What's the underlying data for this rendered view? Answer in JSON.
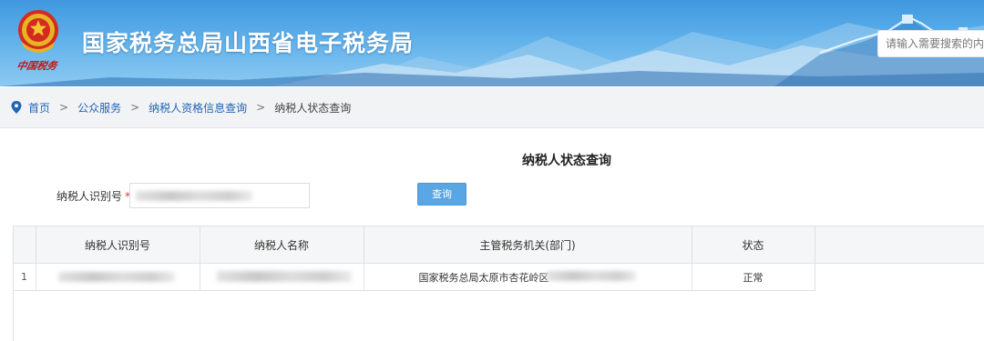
{
  "header": {
    "site_title": "国家税务总局山西省电子税务局",
    "emblem_caption": "中国税务",
    "search_placeholder": "请输入需要搜索的内容"
  },
  "breadcrumb": {
    "items": [
      "首页",
      "公众服务",
      "纳税人资格信息查询",
      "纳税人状态查询"
    ],
    "separator": ">"
  },
  "main": {
    "heading": "纳税人状态查询",
    "form": {
      "tin_label": "纳税人识别号",
      "required_mark": "*",
      "query_button": "查询"
    },
    "table": {
      "columns": [
        "纳税人识别号",
        "纳税人名称",
        "主管税务机关(部门)",
        "状态"
      ],
      "rows": [
        {
          "index": "1",
          "authority_visible": "国家税务总局太原市杏花岭区",
          "status": "正常"
        }
      ]
    }
  },
  "colors": {
    "banner_blue": "#3f98df",
    "link_blue": "#1f64b5",
    "button_blue": "#5aa6e4",
    "required_red": "#e53333"
  }
}
